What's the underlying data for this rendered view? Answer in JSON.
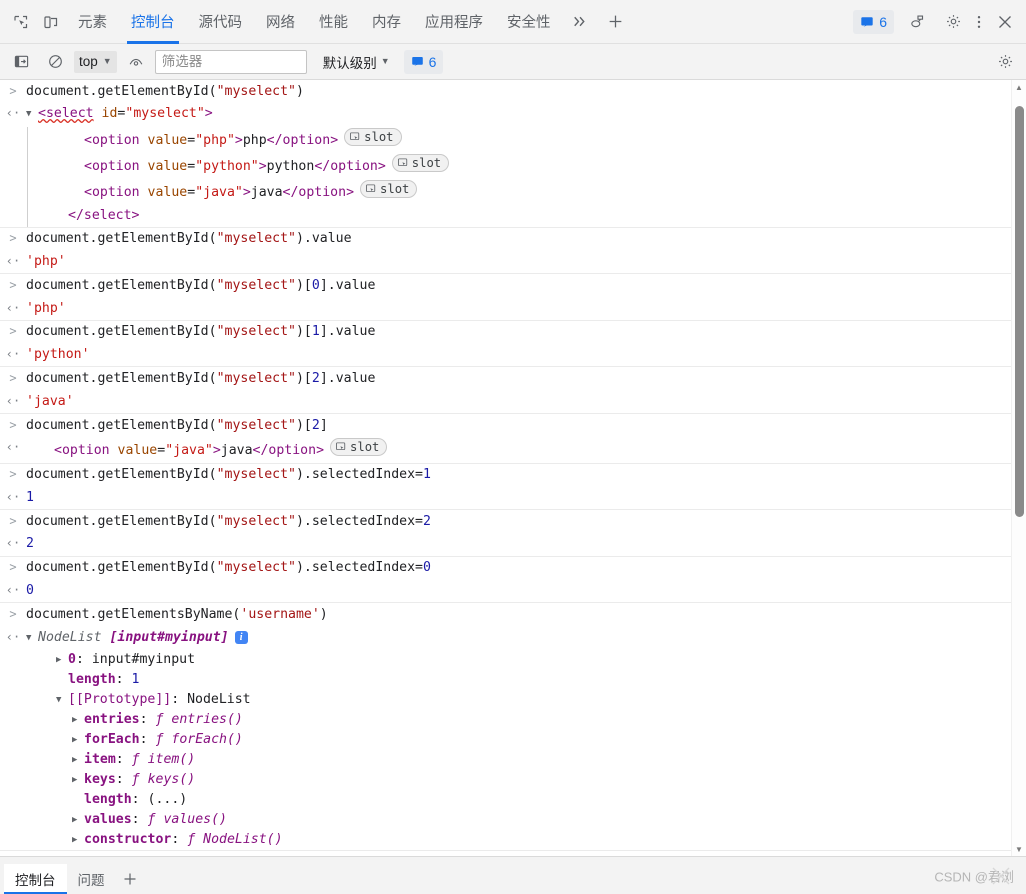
{
  "tabstrip": {
    "icons": [
      {
        "name": "inspect-element-icon"
      },
      {
        "name": "device-toolbar-icon"
      }
    ],
    "tabs": [
      {
        "label": "元素",
        "active": false
      },
      {
        "label": "控制台",
        "active": true
      },
      {
        "label": "源代码",
        "active": false
      },
      {
        "label": "网络",
        "active": false
      },
      {
        "label": "性能",
        "active": false
      },
      {
        "label": "内存",
        "active": false
      },
      {
        "label": "应用程序",
        "active": false
      },
      {
        "label": "安全性",
        "active": false
      }
    ],
    "more_tabs_icon": "chevron-double-right-icon",
    "add_tab_icon": "plus-icon",
    "message_count": "6",
    "feedback_icon": "feedback-icon",
    "settings_icon": "gear-icon",
    "more_icon": "kebab-menu-icon",
    "close_icon": "close-icon"
  },
  "consolebar": {
    "sidebar_toggle_icon": "show-console-sidebar-icon",
    "clear_icon": "clear-console-icon",
    "context": "top",
    "live_expression_icon": "eye-icon",
    "filter_placeholder": "筛选器",
    "filter_value": "",
    "level_label": "默认级别",
    "message_count": "6",
    "settings_icon": "gear-icon"
  },
  "console": {
    "entries": [
      {
        "id": "g1",
        "input": "document.getElementById(\"myselect\")",
        "input_parts": [
          {
            "t": "document.getElementById(",
            "c": "plain"
          },
          {
            "t": "\"myselect\"",
            "c": "str"
          },
          {
            "t": ")",
            "c": "plain"
          }
        ],
        "output_type": "dom",
        "dom": {
          "open_tag_name": "select",
          "open_attr_name": "id",
          "open_attr_value": "\"myselect\"",
          "children": [
            {
              "tag": "option",
              "attr_name": "value",
              "attr_value": "\"php\"",
              "text": "php",
              "badge": "slot"
            },
            {
              "tag": "option",
              "attr_name": "value",
              "attr_value": "\"python\"",
              "text": "python",
              "badge": "slot"
            },
            {
              "tag": "option",
              "attr_name": "value",
              "attr_value": "\"java\"",
              "text": "java",
              "badge": "slot"
            }
          ],
          "close_tag": "</select>"
        }
      },
      {
        "id": "g2",
        "input_parts": [
          {
            "t": "document.getElementById(",
            "c": "plain"
          },
          {
            "t": "\"myselect\"",
            "c": "str"
          },
          {
            "t": ").value",
            "c": "plain"
          }
        ],
        "output_type": "string",
        "output": "'php'"
      },
      {
        "id": "g3",
        "input_parts": [
          {
            "t": "document.getElementById(",
            "c": "plain"
          },
          {
            "t": "\"myselect\"",
            "c": "str"
          },
          {
            "t": ")[",
            "c": "plain"
          },
          {
            "t": "0",
            "c": "num"
          },
          {
            "t": "].value",
            "c": "plain"
          }
        ],
        "output_type": "string",
        "output": "'php'"
      },
      {
        "id": "g4",
        "input_parts": [
          {
            "t": "document.getElementById(",
            "c": "plain"
          },
          {
            "t": "\"myselect\"",
            "c": "str"
          },
          {
            "t": ")[",
            "c": "plain"
          },
          {
            "t": "1",
            "c": "num"
          },
          {
            "t": "].value",
            "c": "plain"
          }
        ],
        "output_type": "string",
        "output": "'python'"
      },
      {
        "id": "g5",
        "input_parts": [
          {
            "t": "document.getElementById(",
            "c": "plain"
          },
          {
            "t": "\"myselect\"",
            "c": "str"
          },
          {
            "t": ")[",
            "c": "plain"
          },
          {
            "t": "2",
            "c": "num"
          },
          {
            "t": "].value",
            "c": "plain"
          }
        ],
        "output_type": "string",
        "output": "'java'"
      },
      {
        "id": "g6",
        "input_parts": [
          {
            "t": "document.getElementById(",
            "c": "plain"
          },
          {
            "t": "\"myselect\"",
            "c": "str"
          },
          {
            "t": ")[",
            "c": "plain"
          },
          {
            "t": "2",
            "c": "num"
          },
          {
            "t": "]",
            "c": "plain"
          }
        ],
        "output_type": "dom-single",
        "dom_single": {
          "tag": "option",
          "attr_name": "value",
          "attr_value": "\"java\"",
          "text": "java",
          "badge": "slot"
        }
      },
      {
        "id": "g7",
        "input_parts": [
          {
            "t": "document.getElementById(",
            "c": "plain"
          },
          {
            "t": "\"myselect\"",
            "c": "str"
          },
          {
            "t": ").selectedIndex=",
            "c": "plain"
          },
          {
            "t": "1",
            "c": "num"
          }
        ],
        "output_type": "number",
        "output": "1"
      },
      {
        "id": "g8",
        "input_parts": [
          {
            "t": "document.getElementById(",
            "c": "plain"
          },
          {
            "t": "\"myselect\"",
            "c": "str"
          },
          {
            "t": ").selectedIndex=",
            "c": "plain"
          },
          {
            "t": "2",
            "c": "num"
          }
        ],
        "output_type": "number",
        "output": "2"
      },
      {
        "id": "g9",
        "input_parts": [
          {
            "t": "document.getElementById(",
            "c": "plain"
          },
          {
            "t": "\"myselect\"",
            "c": "str"
          },
          {
            "t": ").selectedIndex=",
            "c": "plain"
          },
          {
            "t": "0",
            "c": "num"
          }
        ],
        "output_type": "number",
        "output": "0"
      },
      {
        "id": "g10",
        "input_parts": [
          {
            "t": "document.getElementsByName(",
            "c": "plain"
          },
          {
            "t": "'username'",
            "c": "str"
          },
          {
            "t": ")",
            "c": "plain"
          }
        ],
        "output_type": "object",
        "object": {
          "class_name": "NodeList",
          "preview": "[input#myinput]",
          "has_info_icon": true,
          "rows": [
            {
              "indent": 1,
              "tri": "closed",
              "key": "0",
              "key_bold": true,
              "sep": ": ",
              "value": "input#myinput",
              "vclass": "ob-val"
            },
            {
              "indent": 1,
              "tri": "blank",
              "key": "length",
              "key_bold": true,
              "sep": ": ",
              "value": "1",
              "vclass": "ob-num"
            },
            {
              "indent": 1,
              "tri": "open",
              "key": "[[Prototype]]",
              "key_bold": false,
              "key_plain": true,
              "sep": ": ",
              "value": "NodeList",
              "vclass": "ob-proto"
            },
            {
              "indent": 2,
              "tri": "closed",
              "key": "entries",
              "key_bold": true,
              "sep": ": ",
              "fn": true,
              "value": "entries()"
            },
            {
              "indent": 2,
              "tri": "closed",
              "key": "forEach",
              "key_bold": true,
              "sep": ": ",
              "fn": true,
              "value": "forEach()"
            },
            {
              "indent": 2,
              "tri": "closed",
              "key": "item",
              "key_bold": true,
              "sep": ": ",
              "fn": true,
              "value": "item()"
            },
            {
              "indent": 2,
              "tri": "closed",
              "key": "keys",
              "key_bold": true,
              "sep": ": ",
              "fn": true,
              "value": "keys()"
            },
            {
              "indent": 2,
              "tri": "blank",
              "key": "length",
              "key_bold": true,
              "sep": ": ",
              "value": "(...)",
              "vclass": "ob-val"
            },
            {
              "indent": 2,
              "tri": "closed",
              "key": "values",
              "key_bold": true,
              "sep": ": ",
              "fn": true,
              "value": "values()"
            },
            {
              "indent": 2,
              "tri": "closed",
              "key": "constructor",
              "key_bold": true,
              "sep": ": ",
              "fn": true,
              "value": "NodeList()"
            }
          ]
        }
      }
    ]
  },
  "scrollbar": {
    "thumb_top_pct": 1.5,
    "thumb_height_pct": 53
  },
  "drawer": {
    "tabs": [
      {
        "label": "控制台",
        "active": true
      },
      {
        "label": "问题",
        "active": false
      }
    ],
    "add_icon": "plus-icon",
    "watermark": "CSDN @君浏"
  }
}
